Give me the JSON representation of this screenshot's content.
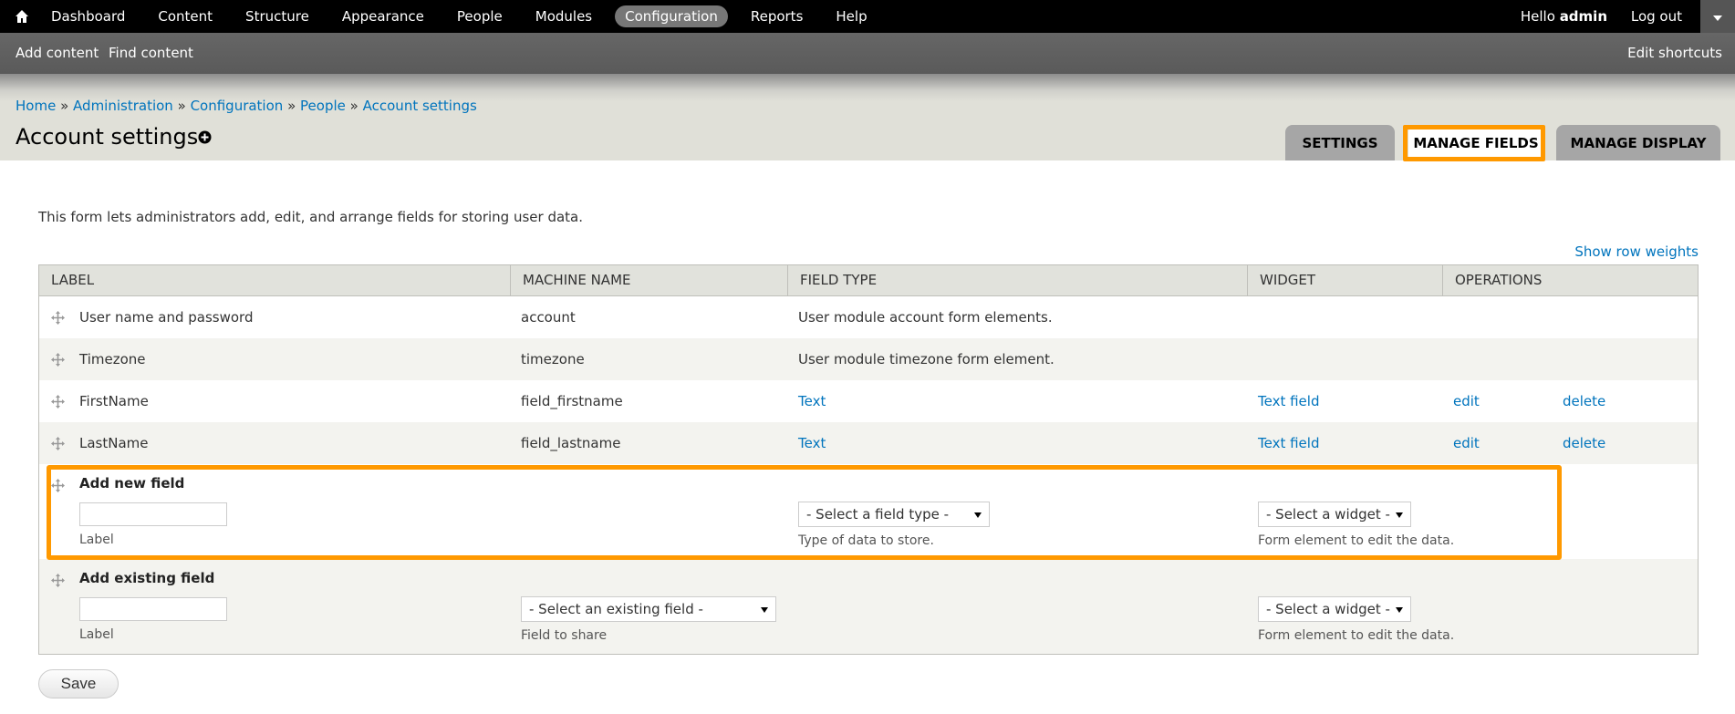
{
  "toolbar": {
    "items": [
      "Dashboard",
      "Content",
      "Structure",
      "Appearance",
      "People",
      "Modules",
      "Configuration",
      "Reports",
      "Help"
    ],
    "active_index": 6,
    "hello_prefix": "Hello",
    "user": "admin",
    "logout": "Log out",
    "icons": {
      "home": "home-icon",
      "toggle": "chevron-down-icon"
    }
  },
  "shortcuts": {
    "items": [
      "Add content",
      "Find content"
    ],
    "edit": "Edit shortcuts"
  },
  "breadcrumb": {
    "items": [
      "Home",
      "Administration",
      "Configuration",
      "People",
      "Account settings"
    ],
    "separator": "»"
  },
  "page": {
    "title": "Account settings"
  },
  "tabs": {
    "settings": "SETTINGS",
    "manage_fields": "MANAGE FIELDS",
    "manage_display": "MANAGE DISPLAY"
  },
  "content": {
    "description": "This form lets administrators add, edit, and arrange fields for storing user data.",
    "row_weights": "Show row weights"
  },
  "table": {
    "headers": [
      "LABEL",
      "MACHINE NAME",
      "FIELD TYPE",
      "WIDGET",
      "OPERATIONS"
    ],
    "rows": [
      {
        "label": "User name and password",
        "machine": "account",
        "type": "User module account form elements.",
        "widget": "",
        "edit": "",
        "delete": ""
      },
      {
        "label": "Timezone",
        "machine": "timezone",
        "type": "User module timezone form element.",
        "widget": "",
        "edit": "",
        "delete": ""
      },
      {
        "label": "FirstName",
        "machine": "field_firstname",
        "type": "Text",
        "widget": "Text field",
        "edit": "edit",
        "delete": "delete"
      },
      {
        "label": "LastName",
        "machine": "field_lastname",
        "type": "Text",
        "widget": "Text field",
        "edit": "edit",
        "delete": "delete"
      }
    ],
    "add_new": {
      "title": "Add new field",
      "label_hint": "Label",
      "type_select": "- Select a field type -",
      "type_hint": "Type of data to store.",
      "widget_select": "- Select a widget -",
      "widget_hint": "Form element to edit the data."
    },
    "add_existing": {
      "title": "Add existing field",
      "label_hint": "Label",
      "field_select": "- Select an existing field -",
      "field_hint": "Field to share",
      "widget_select": "- Select a widget -",
      "widget_hint": "Form element to edit the data."
    }
  },
  "save_label": "Save",
  "colors": {
    "highlight": "#ff9900",
    "link": "#0074bd"
  }
}
